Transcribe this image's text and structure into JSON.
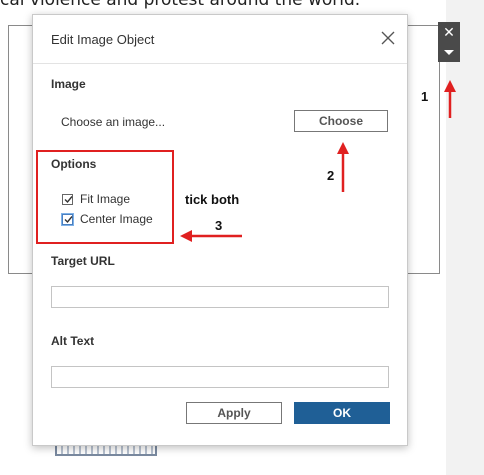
{
  "background": {
    "article_text": "cal violence and protest around the world."
  },
  "dialog": {
    "title": "Edit Image Object",
    "image_section": {
      "label": "Image",
      "choose_prompt": "Choose an image...",
      "choose_button": "Choose"
    },
    "options_section": {
      "label": "Options",
      "fit_image": {
        "label": "Fit Image",
        "checked": true
      },
      "center_image": {
        "label": "Center Image",
        "checked": true
      }
    },
    "target_url": {
      "label": "Target URL",
      "value": "",
      "placeholder": ""
    },
    "alt_text": {
      "label": "Alt Text",
      "value": "",
      "placeholder": ""
    },
    "buttons": {
      "apply": "Apply",
      "ok": "OK"
    }
  },
  "window_controls": {
    "close_icon": "close-icon",
    "menu_icon": "caret-down-icon"
  },
  "annotations": {
    "step_1": "1",
    "step_2": "2",
    "step_3": "3",
    "note": "tick both"
  },
  "colors": {
    "annotation_red": "#e02020",
    "primary_button": "#1f5f96",
    "control_dark": "#4a4a4a"
  }
}
